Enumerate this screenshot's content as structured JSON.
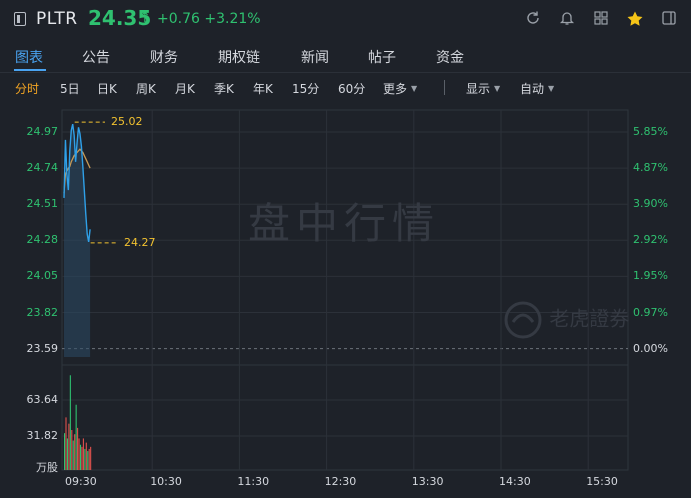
{
  "header": {
    "symbol": "PLTR",
    "price": "24.35",
    "arrow": "↑",
    "change": "+0.76",
    "change_pct": "+3.21%",
    "colors": {
      "up": "#2fc170",
      "accent": "#4aa3f0",
      "star": "#f5c518"
    }
  },
  "toolbar_icons": [
    "refresh-icon",
    "bell-icon",
    "grid-icon",
    "star-icon",
    "panel-icon"
  ],
  "tabs": [
    {
      "label": "图表",
      "active": true
    },
    {
      "label": "公告"
    },
    {
      "label": "财务"
    },
    {
      "label": "期权链"
    },
    {
      "label": "新闻"
    },
    {
      "label": "帖子"
    },
    {
      "label": "资金"
    }
  ],
  "subtabs": [
    {
      "label": "分时",
      "active": true
    },
    {
      "label": "5日"
    },
    {
      "label": "日K"
    },
    {
      "label": "周K"
    },
    {
      "label": "月K"
    },
    {
      "label": "季K"
    },
    {
      "label": "年K"
    },
    {
      "label": "15分"
    },
    {
      "label": "60分"
    },
    {
      "label": "更多"
    }
  ],
  "display_label": "显示",
  "auto_label": "自动",
  "watermark": "盘中行情",
  "brand_watermark": "老虎證券",
  "chart_data": {
    "type": "line",
    "price_axis": [
      "24.97",
      "24.74",
      "24.51",
      "24.28",
      "24.05",
      "23.82",
      "23.59"
    ],
    "pct_axis": [
      "5.85%",
      "4.87%",
      "3.90%",
      "2.92%",
      "1.95%",
      "0.97%",
      "0.00%"
    ],
    "volume_axis": [
      "63.64",
      "31.82",
      "万股"
    ],
    "time_axis": [
      "09:30",
      "10:30",
      "11:30",
      "12:30",
      "13:30",
      "14:30",
      "15:30"
    ],
    "high_label": "25.02",
    "low_label": "24.27",
    "prev_close": 23.59,
    "price_series": [
      24.55,
      24.92,
      24.7,
      24.6,
      24.85,
      24.98,
      25.02,
      24.95,
      24.78,
      24.9,
      25.0,
      24.96,
      24.88,
      24.75,
      24.6,
      24.45,
      24.32,
      24.27,
      24.35
    ],
    "avg_series": [
      24.58,
      24.7,
      24.72,
      24.74,
      24.75,
      24.78,
      24.8,
      24.82,
      24.83,
      24.84,
      24.85,
      24.86,
      24.85,
      24.84,
      24.82,
      24.8,
      24.78,
      24.76,
      24.74
    ],
    "volume": [
      35,
      50,
      30,
      44,
      90,
      38,
      28,
      34,
      62,
      40,
      30,
      24,
      22,
      30,
      20,
      26,
      18,
      20,
      22
    ],
    "volume_colors": [
      "up",
      "down",
      "up",
      "down",
      "up",
      "down",
      "up",
      "down",
      "up",
      "down",
      "down",
      "up",
      "down",
      "down",
      "up",
      "down",
      "up",
      "down",
      "down"
    ]
  }
}
